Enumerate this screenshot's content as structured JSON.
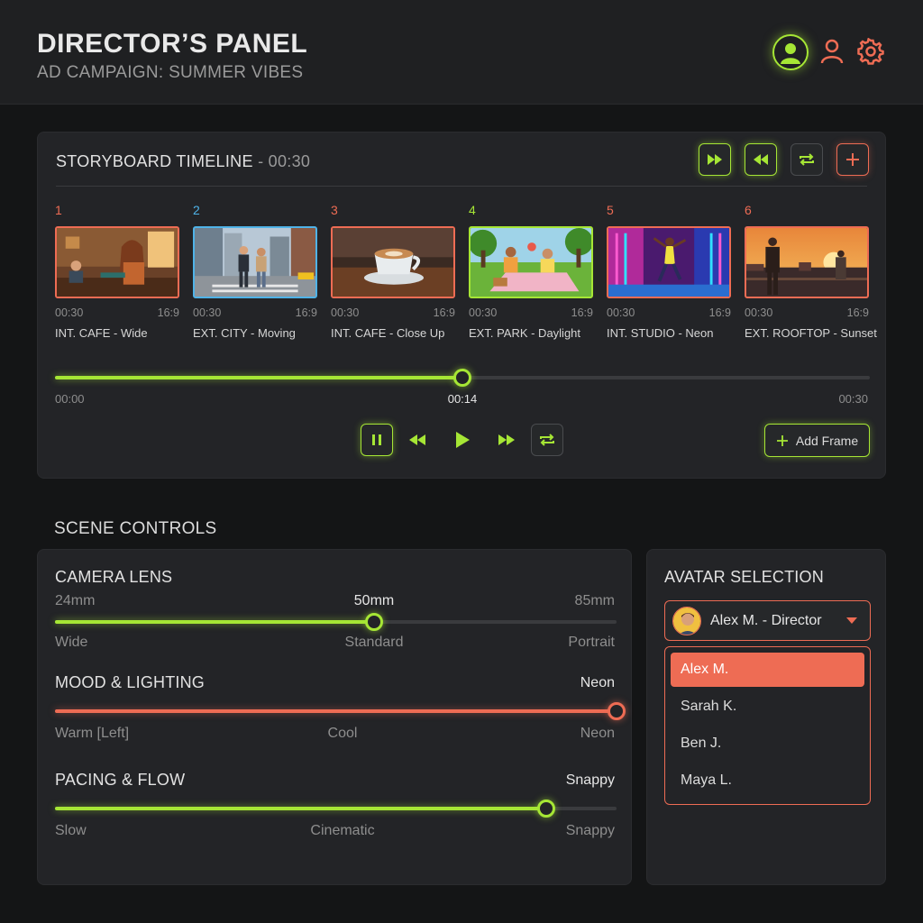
{
  "header": {
    "title": "DIRECTOR’S PANEL",
    "subtitle": "AD CAMPAIGN: SUMMER VIBES",
    "icons": [
      "avatar-icon",
      "user-icon",
      "gear-icon"
    ]
  },
  "storyboard": {
    "title": "STORYBOARD TIMELINE",
    "duration": " - 00:30",
    "toolbar_icons": [
      "fast-forward-icon",
      "rewind-icon",
      "repeat-icon",
      "plus-icon"
    ],
    "frames": [
      {
        "num": "1",
        "duration": "00:30",
        "ratio": "16:9",
        "label": "INT. CAFE - Wide",
        "color": "#ee6c54"
      },
      {
        "num": "2",
        "duration": "00:30",
        "ratio": "16:9",
        "label": "EXT. CITY - Moving",
        "color": "#4fb3e8"
      },
      {
        "num": "3",
        "duration": "00:30",
        "ratio": "16:9",
        "label": "INT. CAFE - Close Up",
        "color": "#ee6c54"
      },
      {
        "num": "4",
        "duration": "00:30",
        "ratio": "16:9",
        "label": "EXT. PARK - Daylight",
        "color": "#a6e635"
      },
      {
        "num": "5",
        "duration": "00:30",
        "ratio": "16:9",
        "label": "INT. STUDIO - Neon",
        "color": "#ee6c54"
      },
      {
        "num": "6",
        "duration": "00:30",
        "ratio": "16:9",
        "label": "EXT. ROOFTOP - Sunset",
        "color": "#ee6c54"
      }
    ],
    "timeline": {
      "start": "00:00",
      "current": "00:14",
      "end": "00:30",
      "progress": 0.5
    },
    "playback_icons": [
      "pause-icon",
      "rewind-icon",
      "play-icon",
      "fast-forward-icon",
      "repeat-icon"
    ],
    "add_frame_label": "Add Frame"
  },
  "scene_controls": {
    "title": "SCENE CONTROLS",
    "camera_lens": {
      "title": "CAMERA LENS",
      "min": "24mm",
      "value": "50mm",
      "max": "85mm",
      "left_label": "Wide",
      "mid_label": "Standard",
      "right_label": "Portrait",
      "level": 0.568
    },
    "mood_lighting": {
      "title": "MOOD & LIGHTING",
      "value": "Neon",
      "left_label": "Warm [Left]",
      "mid_label": "Cool",
      "right_label": "Neon",
      "level": 1.0
    },
    "pacing_flow": {
      "title": "PACING & FLOW",
      "value": "Snappy",
      "left_label": "Slow",
      "mid_label": "Cinematic",
      "right_label": "Snappy",
      "level": 0.874
    }
  },
  "avatar_selection": {
    "title": "AVATAR SELECTION",
    "selected": "Alex M. - Director",
    "options": [
      "Alex M.",
      "Sarah K.",
      "Ben J.",
      "Maya L."
    ],
    "highlighted_index": 0
  },
  "colors": {
    "accent_green": "#a6e635",
    "accent_red": "#ee6c54",
    "accent_blue": "#4fb3e8",
    "background": "#141516",
    "panel": "#232427"
  }
}
